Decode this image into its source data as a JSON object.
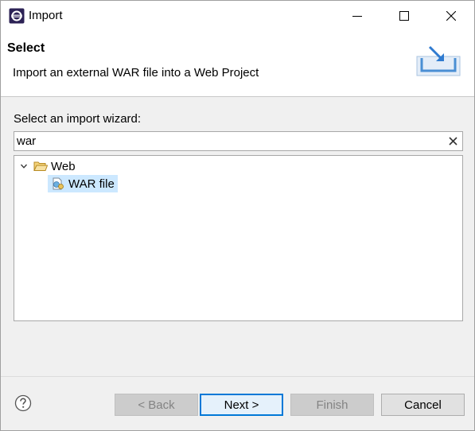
{
  "window": {
    "title": "Import",
    "icon": "eclipse-app-icon"
  },
  "banner": {
    "title": "Select",
    "description": "Import an external WAR file into a Web Project",
    "icon": "import-tray-icon"
  },
  "wizard": {
    "label": "Select an import wizard:",
    "filter_value": "war",
    "tree": [
      {
        "label": "Web",
        "expanded": true,
        "icon": "folder-open-icon",
        "children": [
          {
            "label": "WAR file",
            "selected": true,
            "icon": "war-file-icon"
          }
        ]
      }
    ]
  },
  "buttons": {
    "back": "< Back",
    "next": "Next >",
    "finish": "Finish",
    "cancel": "Cancel"
  },
  "colors": {
    "selection": "#cce8ff",
    "default_button_border": "#0078d7",
    "folder": "#e8b84a"
  }
}
